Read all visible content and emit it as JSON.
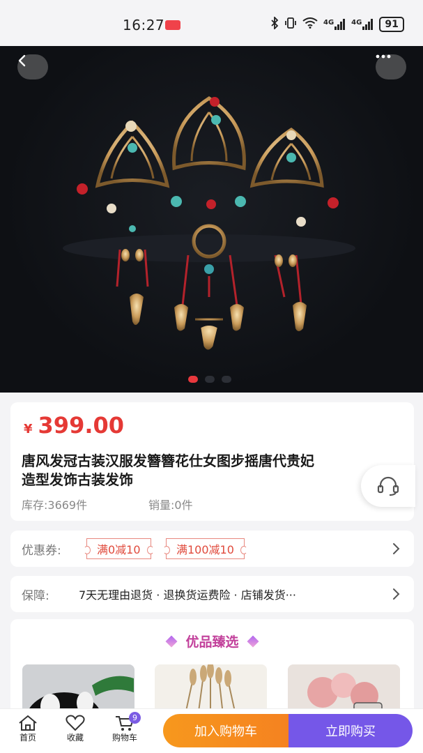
{
  "status_bar": {
    "time": "16:27",
    "network_1": "4G",
    "network_2": "4G",
    "battery": "91"
  },
  "gallery": {
    "active_slide": 1,
    "total_slides": 3
  },
  "product": {
    "currency": "¥",
    "price": "399.00",
    "title": "唐风发冠古装汉服发簪簪花仕女图步摇唐代贵妃\n造型发饰古装发饰",
    "stock": "库存:3669件",
    "sales": "销量:0件"
  },
  "coupons": {
    "label": "优惠券:",
    "items": [
      "满0减10",
      "满100减10"
    ]
  },
  "guarantee": {
    "label": "保障:",
    "text": "7天无理由退货 · 退换货运费险 · 店铺发货···"
  },
  "picks": {
    "title": "优品臻选"
  },
  "bottom_nav": {
    "home": "首页",
    "favorite": "收藏",
    "cart": "购物车",
    "cart_count": "9",
    "add_to_cart": "加入购物车",
    "buy_now": "立即购买"
  },
  "colors": {
    "price": "#e53935",
    "accent_purple": "#7557e8",
    "accent_orange": "#f58220"
  }
}
